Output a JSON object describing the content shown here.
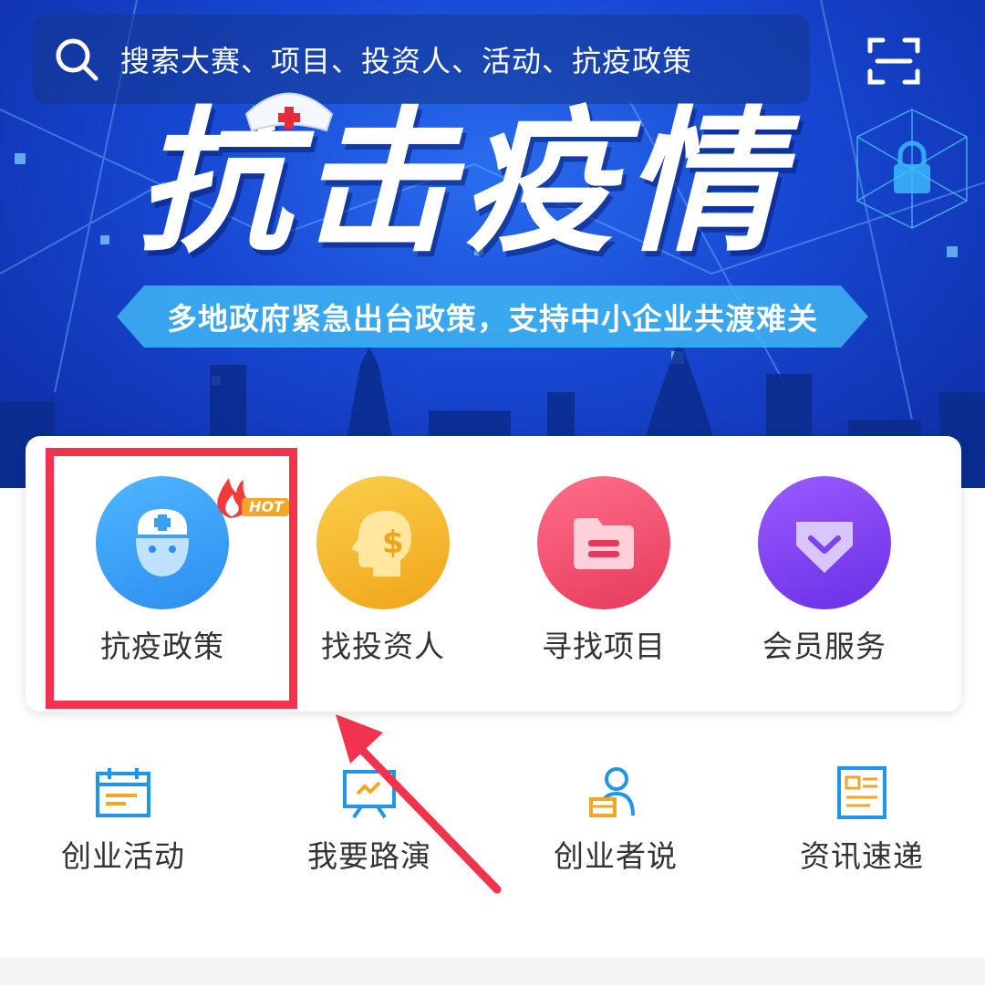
{
  "search": {
    "placeholder": "搜索大赛、项目、投资人、活动、抗疫政策"
  },
  "banner": {
    "title": "抗击疫情",
    "subtitle": "多地政府紧急出台政策，支持中小企业共渡难关"
  },
  "features": [
    {
      "label": "抗疫政策",
      "icon": "medical-mask-icon",
      "color": "#3aa0f5",
      "badge": "HOT"
    },
    {
      "label": "找投资人",
      "icon": "dollar-head-icon",
      "color": "#f2b21f"
    },
    {
      "label": "寻找项目",
      "icon": "folder-icon",
      "color": "#ee4a6b"
    },
    {
      "label": "会员服务",
      "icon": "gem-icon",
      "color": "#7a44f0"
    }
  ],
  "quick_links": [
    {
      "label": "创业活动",
      "icon": "calendar-icon"
    },
    {
      "label": "我要路演",
      "icon": "presentation-board-icon"
    },
    {
      "label": "创业者说",
      "icon": "speaker-user-icon"
    },
    {
      "label": "资讯速递",
      "icon": "news-icon"
    }
  ],
  "colors": {
    "banner_blue": "#1747d2",
    "highlight_red": "#f2334e",
    "icon_blue": "#2196e8",
    "icon_orange": "#f5a623"
  }
}
